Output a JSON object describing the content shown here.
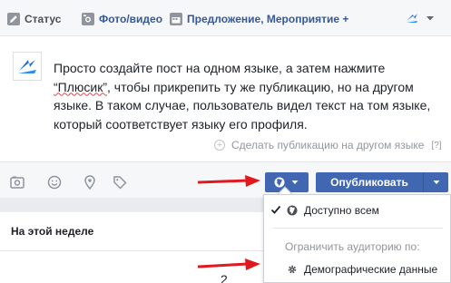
{
  "tabs": [
    {
      "label": "Статус",
      "icon": "pencil-icon"
    },
    {
      "label": "Фото/видео",
      "icon": "camera-icon"
    },
    {
      "label": "Предложение, Мероприятие +",
      "icon": "calendar-icon"
    }
  ],
  "page_selector": {
    "icon": "page-logo-icon"
  },
  "composer": {
    "text_before": "Просто создайте пост на одном языке, а затем нажмите ",
    "text_quoted": "“Плюсик”",
    "text_after": ", чтобы прикрепить ту же публикацию, но на другом языке. В таком случае, пользователь видел текст на том языке, который соответствует языку его профиля.",
    "other_language_label": "Сделать публикацию на другом языке",
    "help_label": "[?]"
  },
  "footer": {
    "publish_label": "Опубликовать"
  },
  "section": {
    "title": "На этой неделе",
    "partial_value": "2"
  },
  "audience_menu": {
    "selected_label": "Доступно всем",
    "restrict_label": "Ограничить аудиторию по:",
    "demographics_label": "Демографические данные"
  },
  "colors": {
    "brand": "#4267b2",
    "link": "#365899",
    "annotation_arrow": "#e0191f"
  }
}
